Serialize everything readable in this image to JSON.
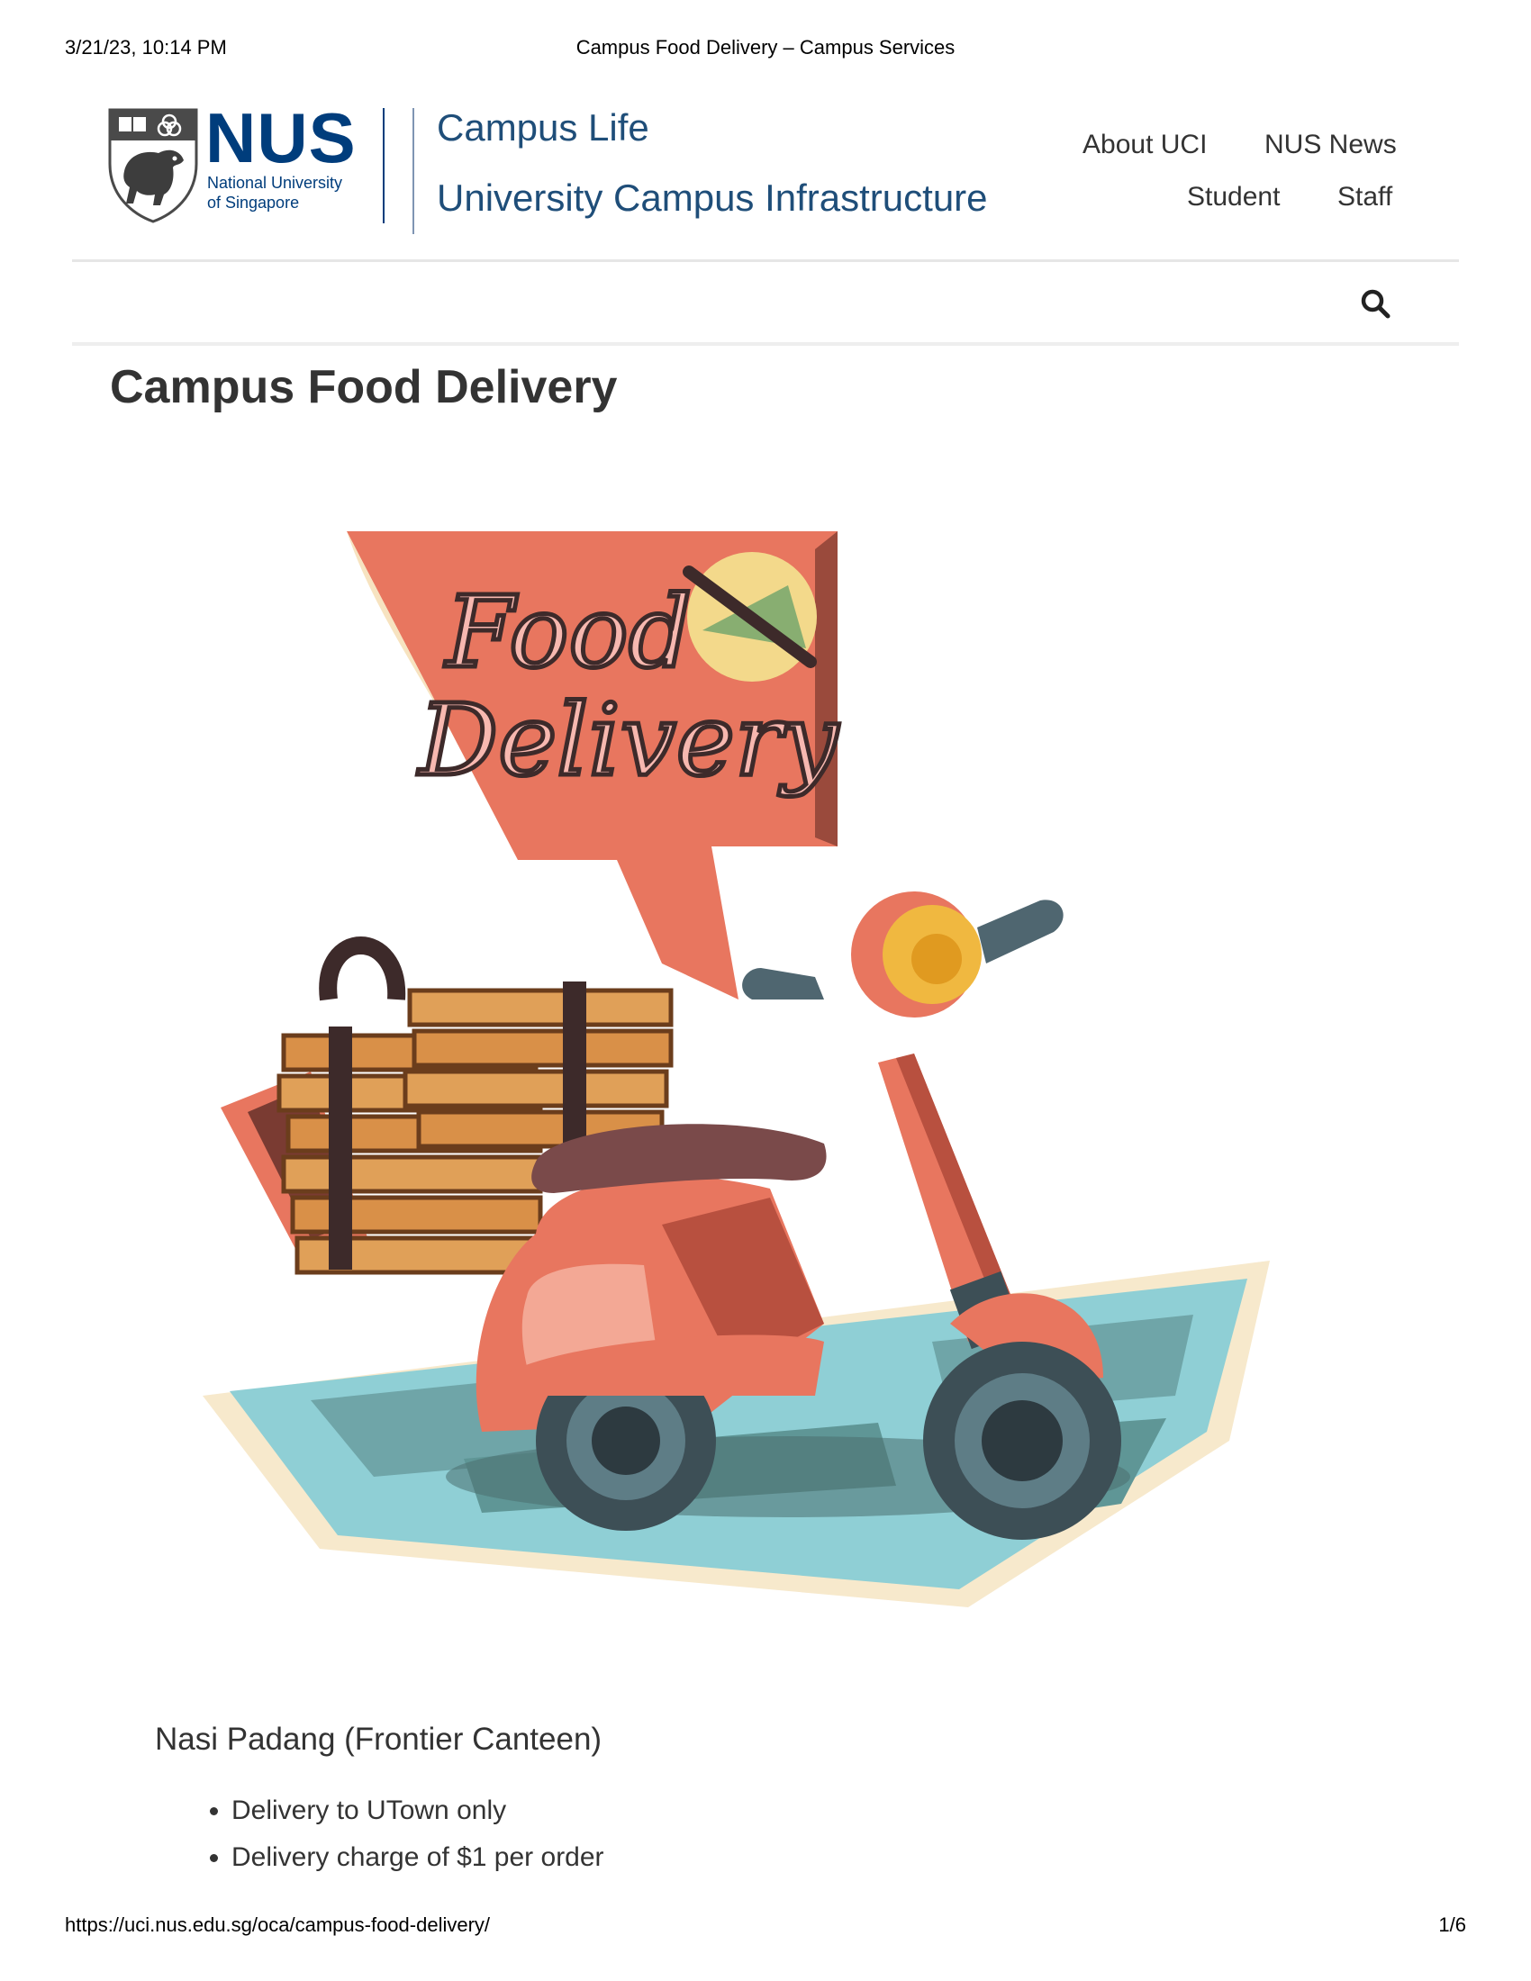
{
  "print_header": {
    "date": "3/21/23, 10:14 PM",
    "title": "Campus Food Delivery – Campus Services"
  },
  "logo": {
    "wordmark": "NUS",
    "line1": "National University",
    "line2": "of Singapore"
  },
  "site": {
    "campus_life": "Campus Life",
    "unit_name": "University Campus Infrastructure"
  },
  "nav": {
    "about": "About UCI",
    "news": "NUS News",
    "student": "Student",
    "staff": "Staff"
  },
  "search": {
    "icon": "search-icon"
  },
  "page": {
    "title": "Campus Food Delivery"
  },
  "hero": {
    "sign_line1": "Food",
    "sign_line2": "Delivery"
  },
  "section": {
    "title": "Nasi Padang (Frontier Canteen)",
    "items": [
      "Delivery to UTown only",
      "Delivery charge of $1 per order"
    ]
  },
  "print_footer": {
    "url": "https://uci.nus.edu.sg/oca/campus-food-delivery/",
    "page": "1/6"
  },
  "colors": {
    "nus_blue": "#003d7c",
    "text": "#333333",
    "coral": "#e8765f",
    "teal": "#8ccfd6"
  }
}
